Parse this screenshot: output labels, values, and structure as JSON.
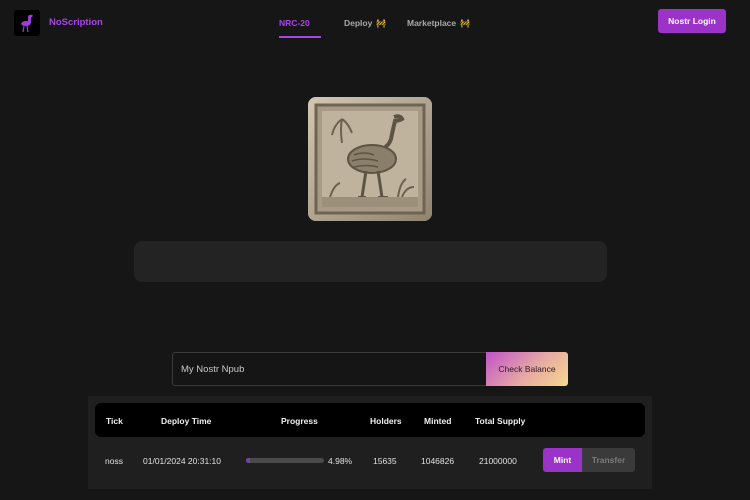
{
  "header": {
    "brand": "NoScription",
    "login_label": "Nostr Login",
    "accent": "#a845e8"
  },
  "nav": {
    "tabs": [
      {
        "label": "NRC-20",
        "active": true
      },
      {
        "label": "Deploy",
        "emoji": "🚧",
        "active": false
      },
      {
        "label": "Marketplace",
        "emoji": "🚧",
        "active": false
      }
    ]
  },
  "hero": {
    "icon": "ostrich-stone-relief"
  },
  "search": {
    "placeholder": "My Nostr Npub",
    "button_label": "Check Balance"
  },
  "table": {
    "columns": [
      "Tick",
      "Deploy Time",
      "Progress",
      "Holders",
      "Minted",
      "Total Supply"
    ],
    "rows": [
      {
        "tick": "noss",
        "deploy_time": "01/01/2024 20:31:10",
        "progress_pct": 4.98,
        "progress_label": "4.98%",
        "holders": "15635",
        "minted": "1046826",
        "total_supply": "21000000",
        "mint_label": "Mint",
        "transfer_label": "Transfer"
      }
    ]
  }
}
